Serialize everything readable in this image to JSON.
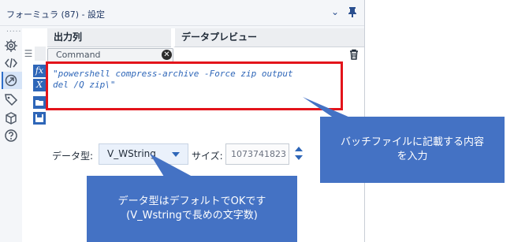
{
  "window": {
    "title": "フォーミュラ (87) - 設定",
    "dots": "....."
  },
  "grid": {
    "col_output": "出力列",
    "col_preview": "データプレビュー",
    "output_field": "Command",
    "expression_line1": "\"powershell compress-archive -Force zip output",
    "expression_line2": "del /Q zip\\\""
  },
  "datatype": {
    "label": "データ型:",
    "value": "V_WString",
    "size_label": "サイズ:",
    "size_value": "1073741823"
  },
  "callouts": {
    "right_line1": "バッチファイルに記載する内容",
    "right_line2": "を入力",
    "bottom_line1": "データ型はデフォルトでOKです",
    "bottom_line2": "(V_Wstringで長めの文字数)"
  },
  "colors": {
    "accent": "#2e66b8",
    "highlight": "#e3141b",
    "callout": "#4472c4"
  },
  "icons": {
    "leftbar": [
      "settings-icon",
      "code-icon",
      "connect-icon",
      "tag-icon",
      "cube-icon",
      "help-icon"
    ]
  }
}
